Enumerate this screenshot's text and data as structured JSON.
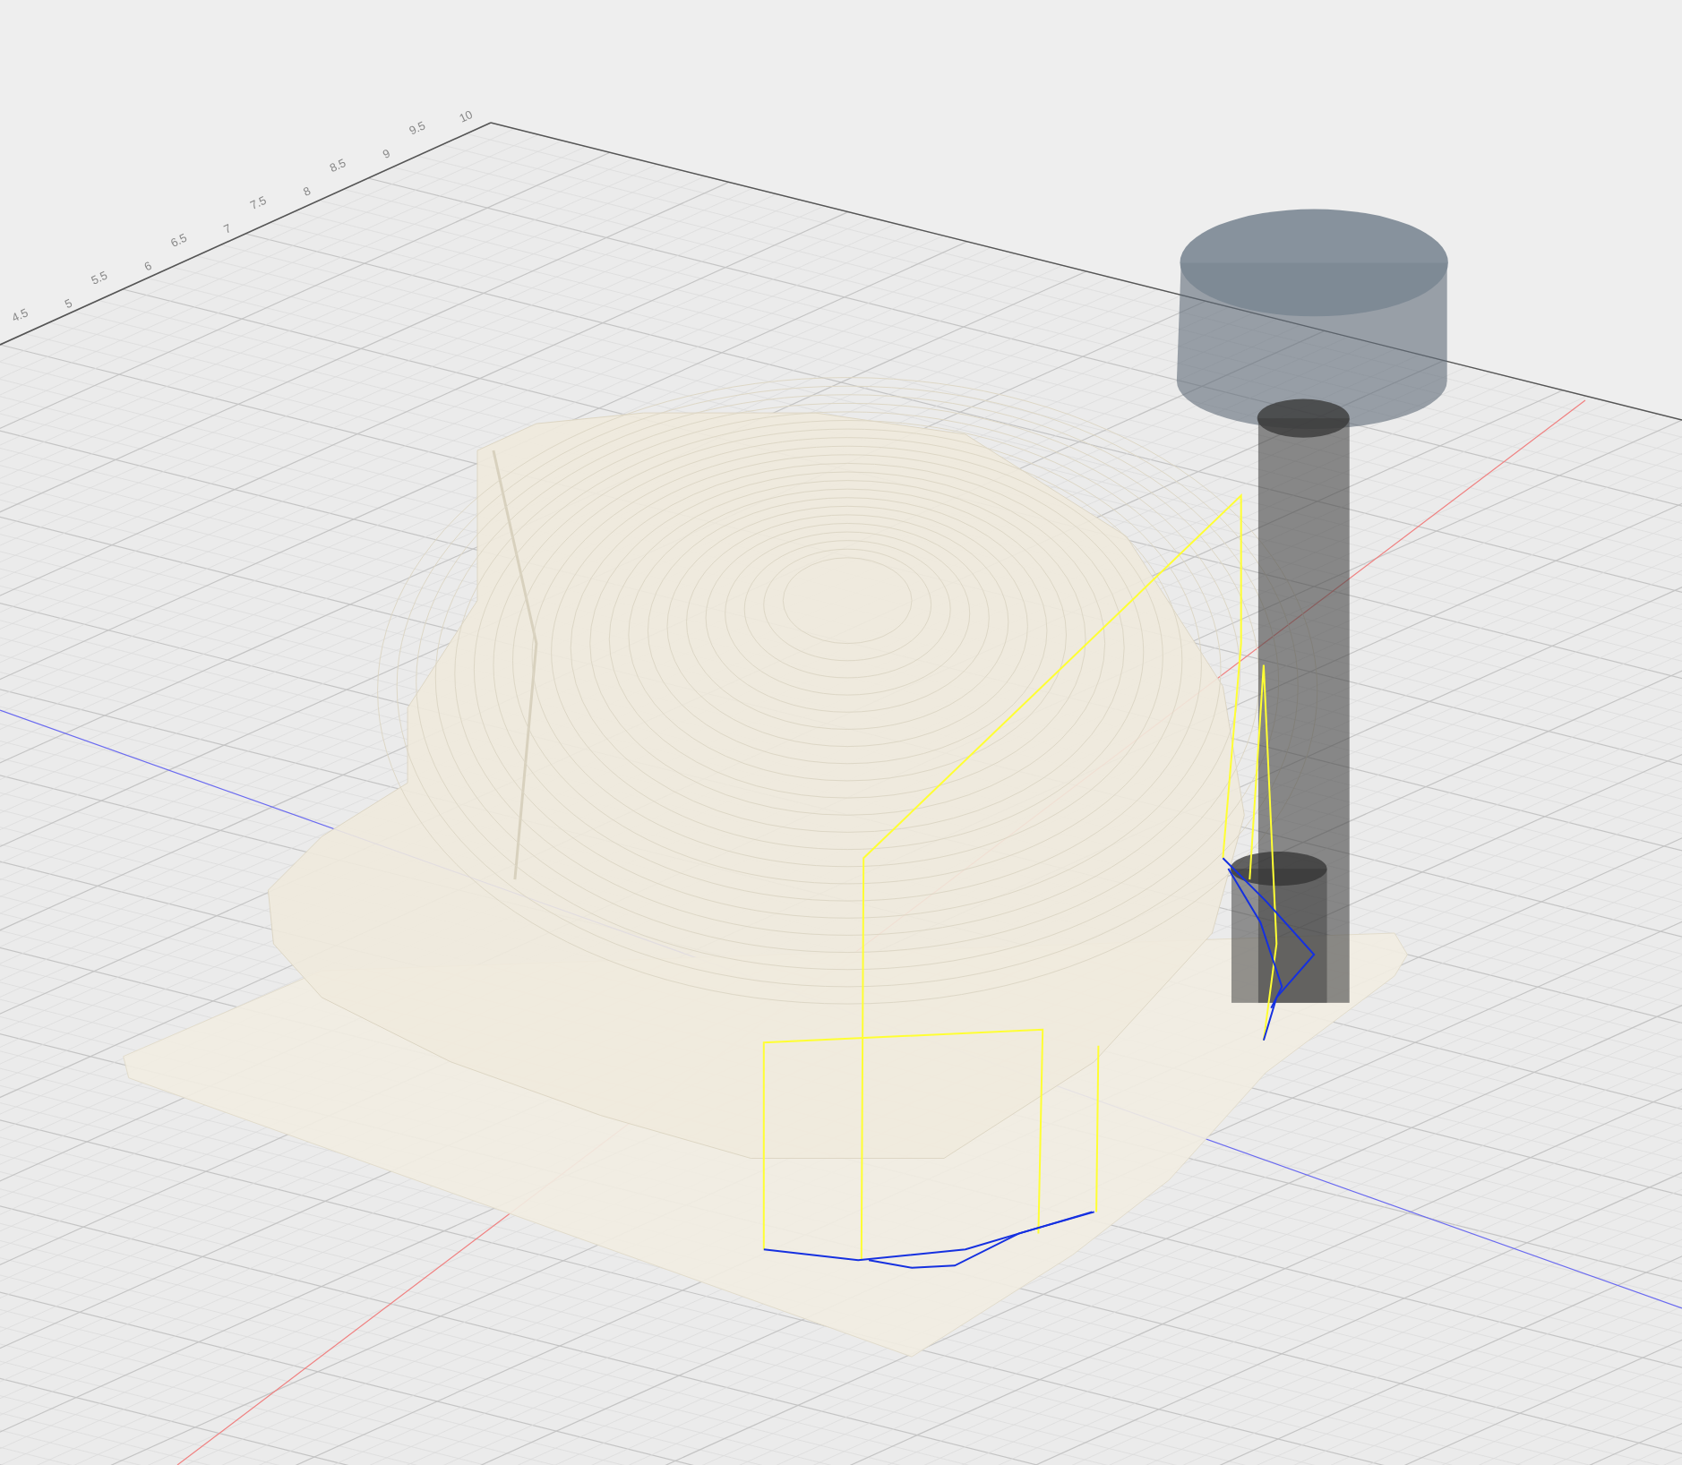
{
  "ruler": {
    "labels": [
      "10",
      "9.5",
      "9",
      "8.5",
      "8",
      "7.5",
      "7",
      "6.5",
      "6",
      "5.5",
      "5",
      "4.5"
    ]
  }
}
